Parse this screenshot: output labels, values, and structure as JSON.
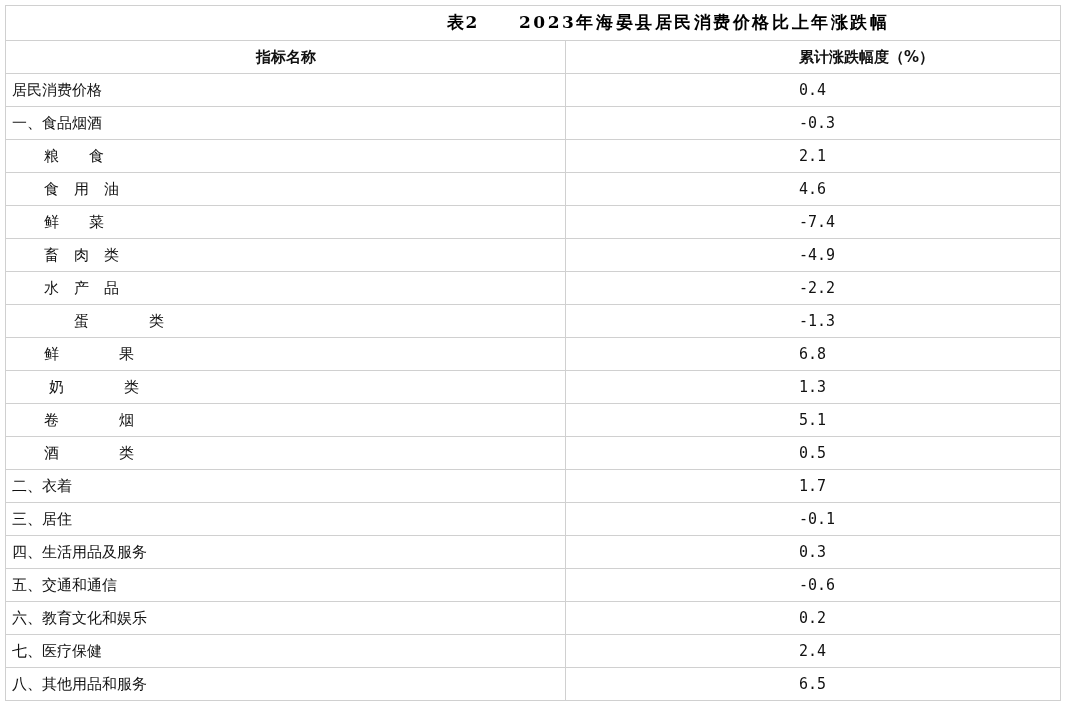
{
  "table": {
    "caption_number": "表2",
    "caption": "2023年海晏县居民消费价格比上年涨跌幅",
    "columns": [
      "指标名称",
      "累计涨跌幅度（%）"
    ],
    "rows": [
      {
        "name": "居民消费价格",
        "value": "0.4"
      },
      {
        "name": "一、食品烟酒",
        "value": "-0.3",
        "children": [
          {
            "name": "粮　　食",
            "value": "2.1"
          },
          {
            "name": "食　用　油",
            "value": "4.6"
          },
          {
            "name": "鲜　　菜",
            "value": "-7.4"
          },
          {
            "name": "畜　肉　类",
            "value": "-4.9"
          },
          {
            "name": "水　产　品",
            "value": "-2.2"
          },
          {
            "name": "　　蛋　　　　类",
            "value": "-1.3"
          },
          {
            "name": "鲜　　　　果",
            "value": "6.8"
          },
          {
            "name": " 奶　　　　类",
            "value": "1.3"
          },
          {
            "name": "卷　　　　烟",
            "value": "5.1"
          },
          {
            "name": "酒　　　　类",
            "value": "0.5"
          }
        ]
      },
      {
        "name": "二、衣着",
        "value": "1.7"
      },
      {
        "name": "三、居住",
        "value": "-0.1"
      },
      {
        "name": "四、生活用品及服务",
        "value": "0.3"
      },
      {
        "name": "五、交通和通信",
        "value": "-0.6"
      },
      {
        "name": "六、教育文化和娱乐",
        "value": "0.2"
      },
      {
        "name": "七、医疗保健",
        "value": "2.4"
      },
      {
        "name": "八、其他用品和服务",
        "value": "6.5"
      }
    ]
  }
}
